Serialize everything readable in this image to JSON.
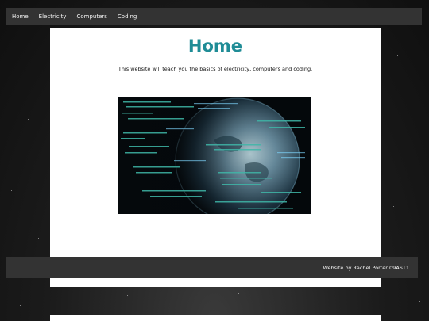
{
  "nav": {
    "items": [
      {
        "label": "Home"
      },
      {
        "label": "Electricity"
      },
      {
        "label": "Computers"
      },
      {
        "label": "Coding"
      }
    ]
  },
  "main": {
    "title": "Home",
    "intro": "This website will teach you the basics of electricity, computers and coding.",
    "hero_image_icon": "earth-with-code-image"
  },
  "footer": {
    "text": "Website by Rachel Porter 09AST1"
  },
  "colors": {
    "title": "#1f8c96",
    "nav_bg": "#333333",
    "footer_bg": "#333333"
  }
}
